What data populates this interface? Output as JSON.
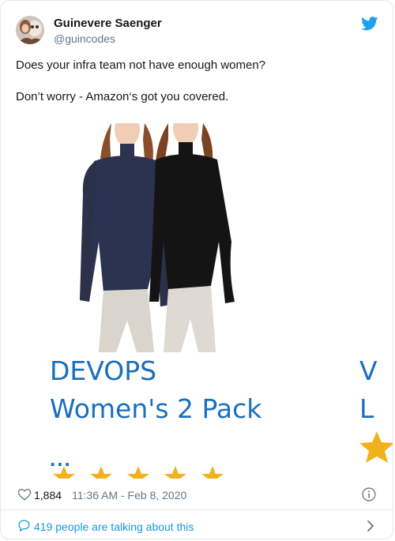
{
  "author": {
    "display_name": "Guinevere Saenger",
    "handle": "@guincodes",
    "avatar": "avatar-photo"
  },
  "tweet": {
    "line_1": "Does your infra team not have enough women?",
    "line_2": "Don’t worry - Amazon‘s got you covered."
  },
  "media": {
    "title_line_1": "DEVOPS",
    "title_line_2": "Women's 2 Pack",
    "ellipsis": "...",
    "next_title_line_1": "V",
    "next_title_line_2": "L",
    "rating_stars": 5,
    "colors": {
      "title": "#1a6fbd",
      "star": "#f0b21a"
    }
  },
  "stats": {
    "likes": "1,884",
    "timestamp": "11:36 AM - Feb 8, 2020"
  },
  "conversation": {
    "label": "419 people are talking about this"
  },
  "colors": {
    "link": "#1b95e0",
    "muted": "#657786"
  },
  "icons": [
    "twitter-bird-icon",
    "heart-icon",
    "info-icon",
    "speech-bubble-icon",
    "chevron-right-icon"
  ]
}
